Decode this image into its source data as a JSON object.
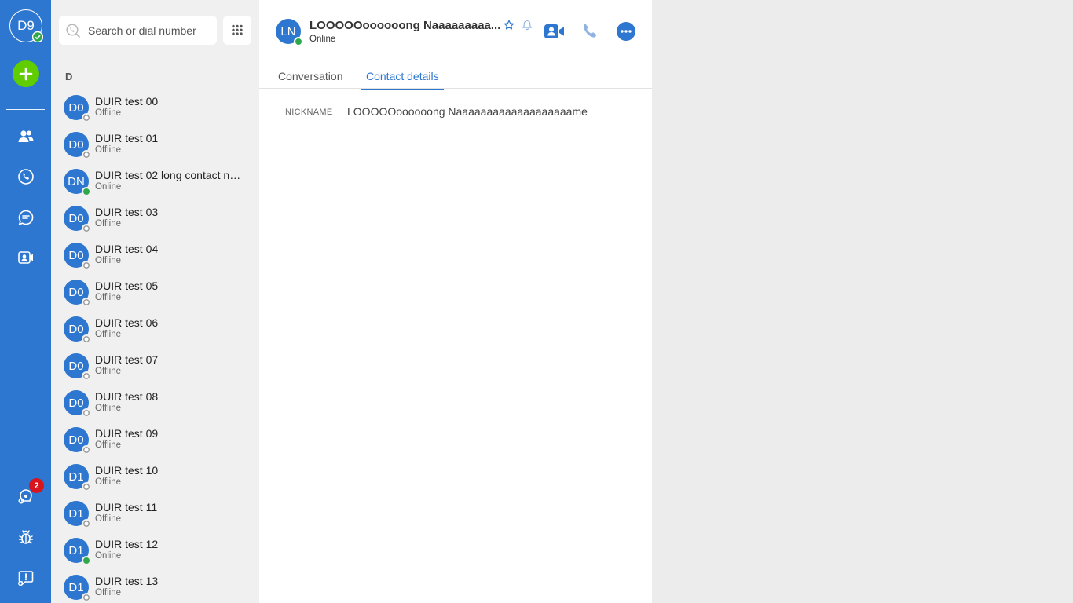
{
  "rail": {
    "user_initials": "D9",
    "notification_count": "2",
    "colors": {
      "rail_bg": "#2e77d0",
      "add_button": "#5fcd00",
      "badge": "#d8141c"
    }
  },
  "search": {
    "placeholder": "Search or dial number"
  },
  "contacts": {
    "section_letter": "D",
    "items": [
      {
        "initials": "D0",
        "name": "DUIR test 00",
        "status": "Offline"
      },
      {
        "initials": "D0",
        "name": "DUIR test 01",
        "status": "Offline"
      },
      {
        "initials": "DN",
        "name": "DUIR test 02 long contact na...",
        "status": "Online"
      },
      {
        "initials": "D0",
        "name": "DUIR test 03",
        "status": "Offline"
      },
      {
        "initials": "D0",
        "name": "DUIR test 04",
        "status": "Offline"
      },
      {
        "initials": "D0",
        "name": "DUIR test 05",
        "status": "Offline"
      },
      {
        "initials": "D0",
        "name": "DUIR test 06",
        "status": "Offline"
      },
      {
        "initials": "D0",
        "name": "DUIR test 07",
        "status": "Offline"
      },
      {
        "initials": "D0",
        "name": "DUIR test 08",
        "status": "Offline"
      },
      {
        "initials": "D0",
        "name": "DUIR test 09",
        "status": "Offline"
      },
      {
        "initials": "D1",
        "name": "DUIR test 10",
        "status": "Offline"
      },
      {
        "initials": "D1",
        "name": "DUIR test 11",
        "status": "Offline"
      },
      {
        "initials": "D1",
        "name": "DUIR test 12",
        "status": "Online"
      },
      {
        "initials": "D1",
        "name": "DUIR test 13",
        "status": "Offline"
      }
    ]
  },
  "header": {
    "initials": "LN",
    "name": "LOOOOOoooooong Naaaaaaaaa...",
    "status": "Online"
  },
  "tabs": [
    {
      "label": "Conversation"
    },
    {
      "label": "Contact details"
    }
  ],
  "details": {
    "nickname_label": "NICKNAME",
    "nickname_value": "LOOOOOoooooong Naaaaaaaaaaaaaaaaaaame"
  }
}
